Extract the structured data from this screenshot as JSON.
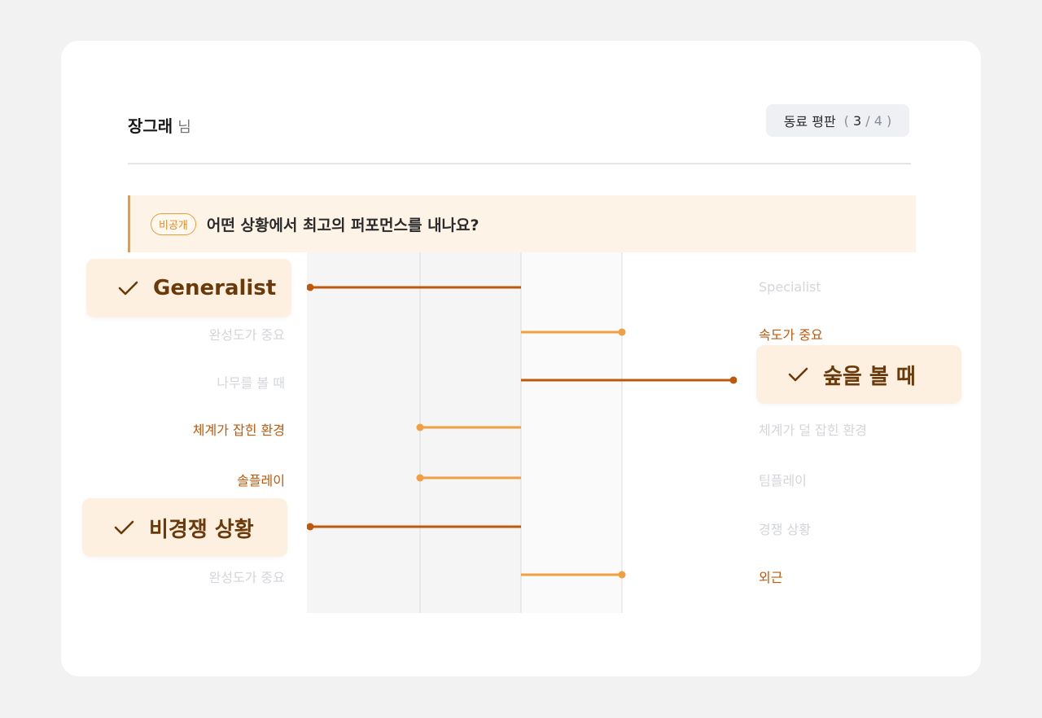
{
  "header": {
    "name": "장그래",
    "name_suffix": "님",
    "badge_label": "동료 평판",
    "badge_current": "3",
    "badge_sep": "/",
    "badge_total": "4"
  },
  "question": {
    "tag": "비공개",
    "text": "어떤 상황에서 최고의 퍼포먼스를 내나요?"
  },
  "rows": [
    {
      "left": "Generalist",
      "right": "Specialist",
      "value": -2,
      "selected": "left"
    },
    {
      "left": "완성도가 중요",
      "right": "속도가 중요",
      "value": 1,
      "selected": "right"
    },
    {
      "left": "나무를 볼 때",
      "right": "숲을 볼 때",
      "value": 2,
      "selected": "right"
    },
    {
      "left": "체계가 잡힌 환경",
      "right": "체계가 덜 잡힌 환경",
      "value": -1,
      "selected": "left"
    },
    {
      "left": "솔플레이",
      "right": "팀플레이",
      "value": -1,
      "selected": "left"
    },
    {
      "left": "비경쟁 상황",
      "right": "경쟁 상황",
      "value": -2,
      "selected": "left"
    },
    {
      "left": "완성도가 중요",
      "right": "외근",
      "value": 1,
      "selected": "right"
    }
  ],
  "highlights": [
    "Generalist",
    "숲을 볼 때",
    "비경쟁 상황"
  ],
  "colors": {
    "strong": "#c0580a",
    "light": "#f0a040",
    "dim_text": "#d3d5db",
    "accent": "#ef9a35"
  },
  "icons": {
    "check": "check-icon"
  }
}
